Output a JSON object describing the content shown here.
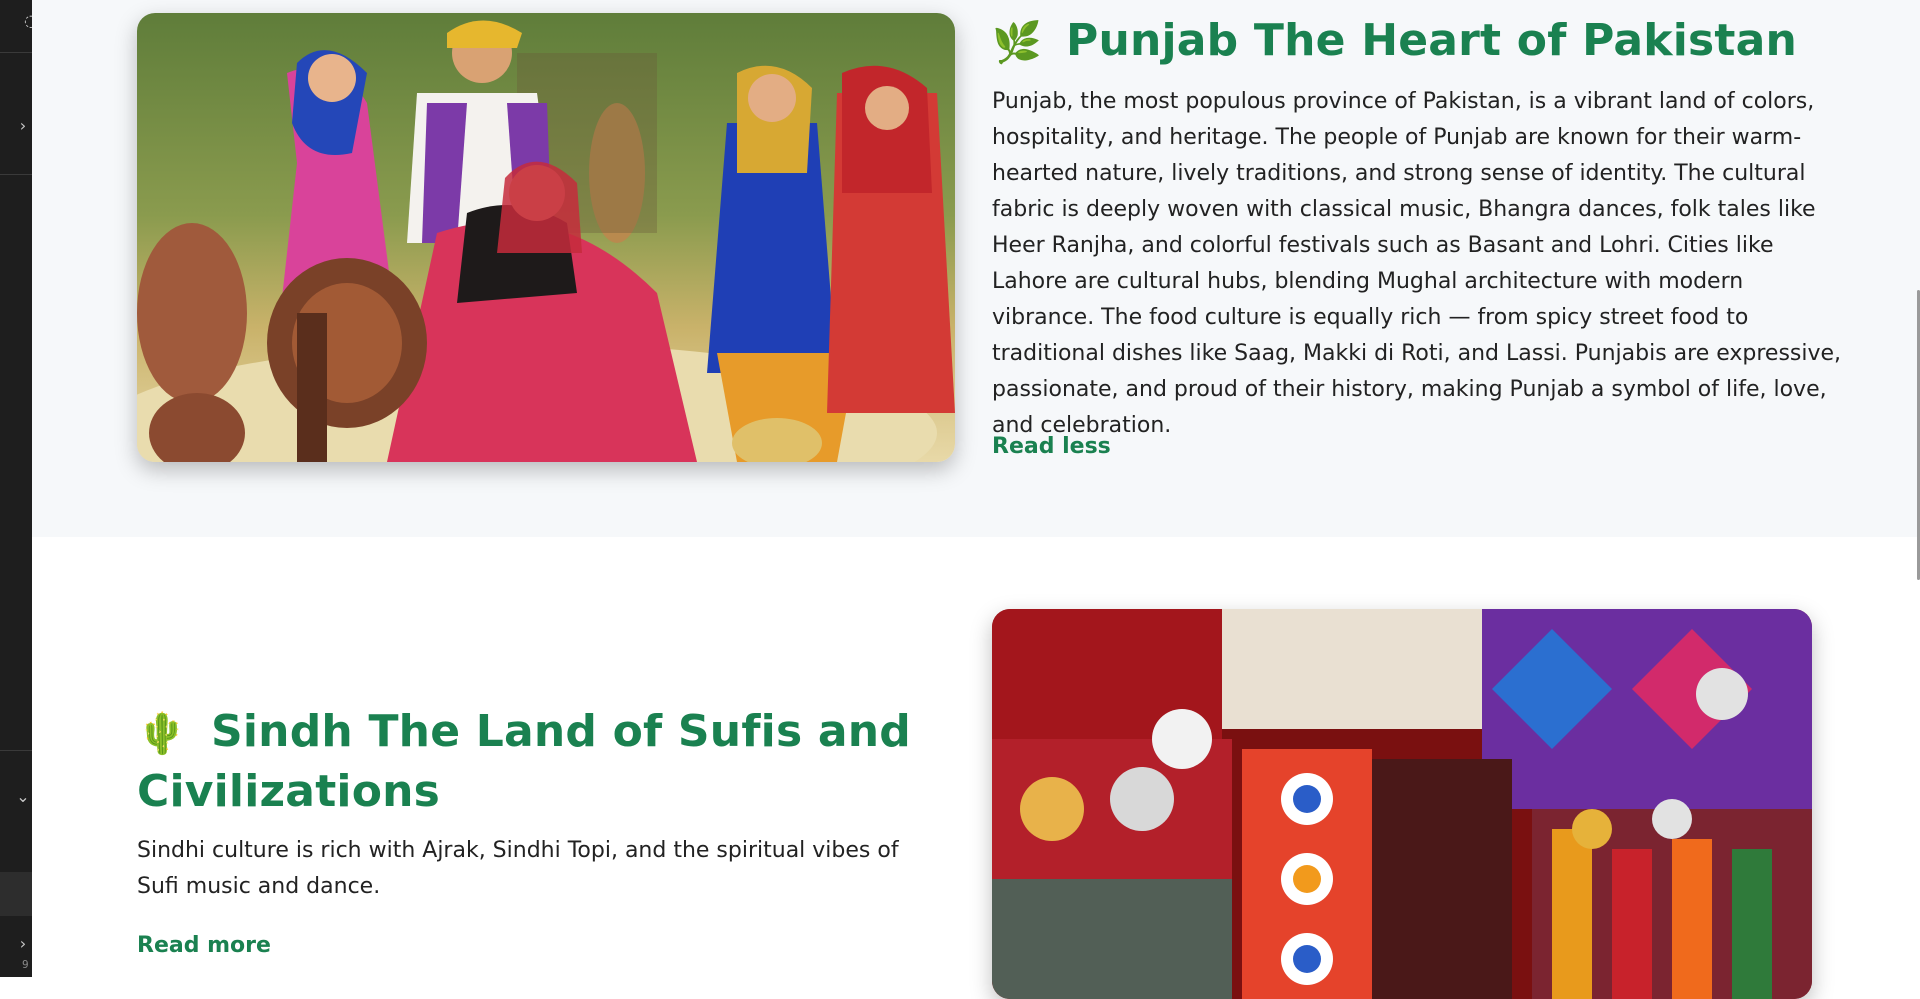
{
  "gutter": {
    "icons": [
      "expand-chevron-right-icon",
      "collapse-chevron-down-icon",
      "expand-chevron-right-icon"
    ],
    "line_number_fragment": "9"
  },
  "punjab": {
    "emoji": "🌿",
    "title": "Punjab The Heart of Pakistan",
    "description": "Punjab, the most populous province of Pakistan, is a vibrant land of colors, hospitality, and heritage. The people of Punjab are known for their warm-hearted nature, lively traditions, and strong sense of identity. The cultural fabric is deeply woven with classical music, Bhangra dances, folk tales like Heer Ranjha, and colorful festivals such as Basant and Lohri. Cities like Lahore are cultural hubs, blending Mughal architecture with modern vibrance. The food culture is equally rich — from spicy street food to traditional dishes like Saag, Makki di Roti, and Lassi. Punjabis are expressive, passionate, and proud of their history, making Punjab a symbol of life, love, and celebration.",
    "toggle_label": "Read less",
    "image_alt": "Punjabi folk dancers in traditional dress around a spinning wheel"
  },
  "sindh": {
    "emoji": "🌵",
    "title": "Sindh The Land of Sufis and Civilizations",
    "description": "Sindhi culture is rich with Ajrak, Sindhi Topi, and the spiritual vibes of Sufi music and dance.",
    "toggle_label": "Read more",
    "image_alt": "Colorful Sindhi embroidered mirror-work textiles and tassels"
  },
  "colors": {
    "accent_green": "#1a8150",
    "section_bg": "#f6f8fa",
    "text": "#222222"
  }
}
